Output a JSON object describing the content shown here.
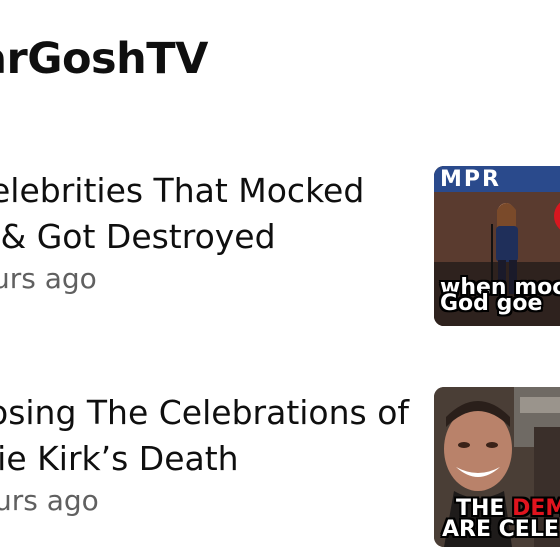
{
  "channel": {
    "name": "arGoshTV"
  },
  "videos": [
    {
      "title_line1": "elebrities That Mocked",
      "title_line2": " & Got Destroyed",
      "meta": "urs ago",
      "thumbnail": {
        "top_banner": "MPR",
        "caption_line1": "when moc",
        "caption_line2": "God goe"
      }
    },
    {
      "title_line1": "osing The Celebrations of",
      "title_line2": "lie Kirk’s Death",
      "meta": "urs ago",
      "thumbnail": {
        "caption_line1_white": "THE ",
        "caption_line1_red": "DEM",
        "caption_line2": "ARE CELE"
      }
    }
  ]
}
